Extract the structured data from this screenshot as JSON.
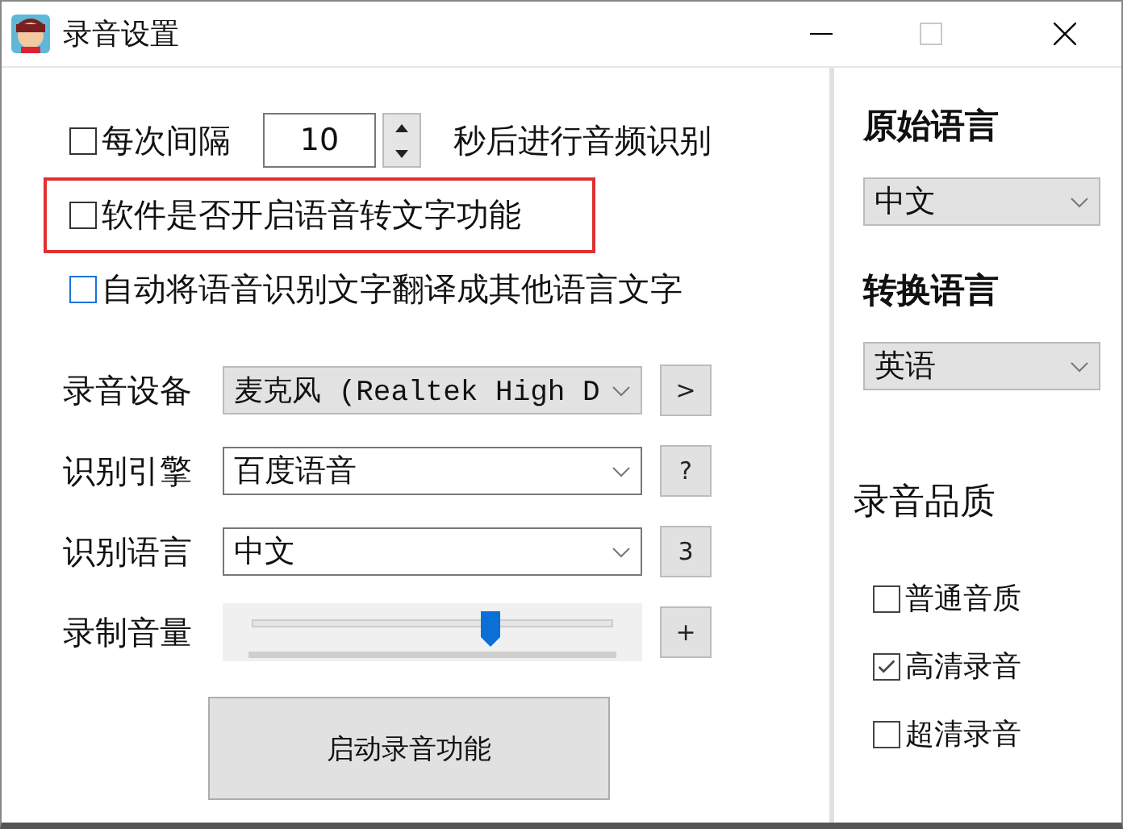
{
  "window": {
    "title": "录音设置",
    "maximize_disabled": true
  },
  "options": [
    {
      "kind": "interval",
      "checked": false,
      "color": "#333333",
      "highlighted": false,
      "label": "每次间隔",
      "value": "10",
      "suffix": "秒后进行音频识别"
    },
    {
      "kind": "plain",
      "checked": false,
      "color": "#333333",
      "highlighted": true,
      "label": "软件是否开启语音转文字功能"
    },
    {
      "kind": "plain",
      "checked": false,
      "color": "#1a73d9",
      "highlighted": false,
      "label": "自动将语音识别文字翻译成其他语言文字"
    }
  ],
  "settings": [
    {
      "kind": "select",
      "label": "录音设备",
      "value": "麦克风 (Realtek High D",
      "disabled": true,
      "button": ">"
    },
    {
      "kind": "select",
      "label": "识别引擎",
      "value": "百度语音",
      "disabled": false,
      "button": "?"
    },
    {
      "kind": "select",
      "label": "识别语言",
      "value": "中文",
      "disabled": false,
      "button": "3"
    },
    {
      "kind": "slider",
      "label": "录制音量",
      "level": 0.66,
      "button": "+"
    }
  ],
  "start_button": "启动录音功能",
  "source_language": {
    "label": "原始语言",
    "value": "中文"
  },
  "target_language": {
    "label": "转换语言",
    "value": "英语"
  },
  "quality": {
    "label": "录音品质",
    "options": [
      {
        "label": "普通音质",
        "checked": false
      },
      {
        "label": "高清录音",
        "checked": true
      },
      {
        "label": "超清录音",
        "checked": false
      }
    ]
  }
}
